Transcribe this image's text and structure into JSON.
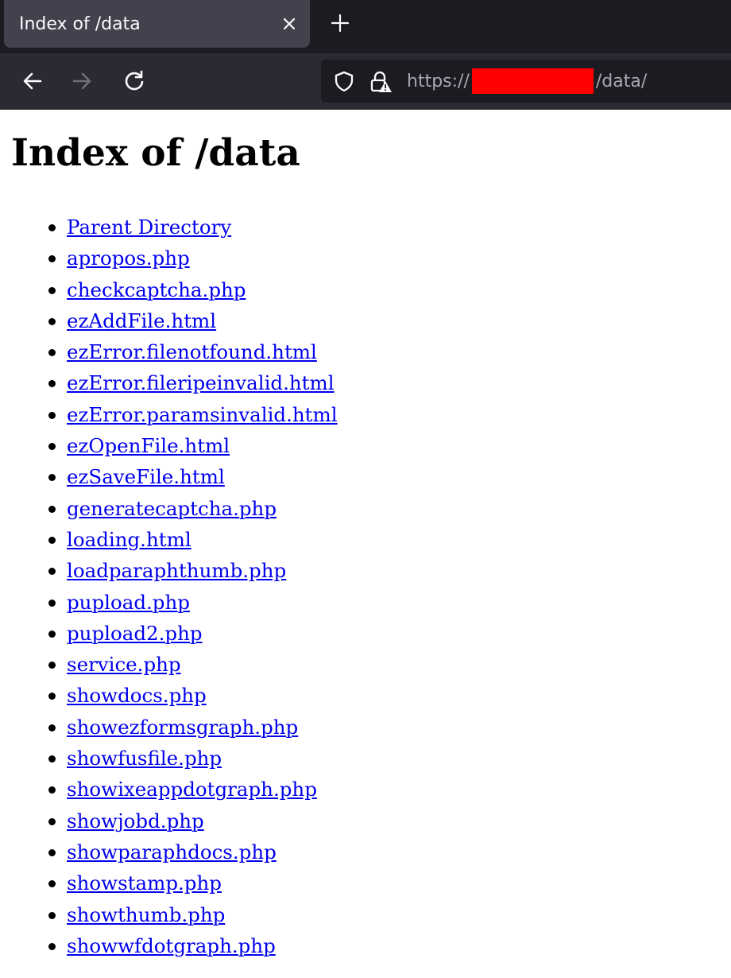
{
  "browser": {
    "tab": {
      "title": "Index of /data"
    },
    "url": {
      "protocol": "https://",
      "path": "/data/"
    }
  },
  "page": {
    "heading": "Index of /data",
    "entries": [
      "Parent Directory",
      "apropos.php",
      "checkcaptcha.php",
      "ezAddFile.html",
      "ezError.filenotfound.html",
      "ezError.fileripeinvalid.html",
      "ezError.paramsinvalid.html",
      "ezOpenFile.html",
      "ezSaveFile.html",
      "generatecaptcha.php",
      "loading.html",
      "loadparaphthumb.php",
      "pupload.php",
      "pupload2.php",
      "service.php",
      "showdocs.php",
      "showezformsgraph.php",
      "showfusfile.php",
      "showixeappdotgraph.php",
      "showjobd.php",
      "showparaphdocs.php",
      "showstamp.php",
      "showthumb.php",
      "showwfdotgraph.php"
    ]
  },
  "colors": {
    "link": "#0000ee",
    "redaction": "#ff0000",
    "tabbar": "#1c1b22",
    "navbar": "#2b2a33"
  },
  "icons": [
    "close-icon",
    "plus-icon",
    "back-arrow-icon",
    "forward-arrow-icon",
    "reload-icon",
    "shield-icon",
    "lock-warning-icon"
  ]
}
